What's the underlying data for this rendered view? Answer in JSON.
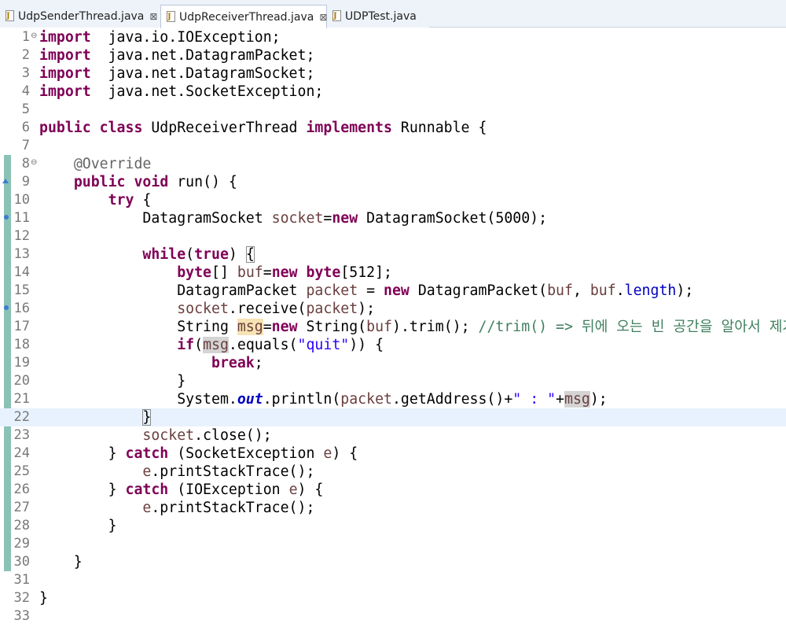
{
  "tabs": [
    {
      "label": "UdpSenderThread.java",
      "close": "⊠",
      "active": false
    },
    {
      "label": "UdpReceiverThread.java",
      "close": "⊠",
      "active": true
    },
    {
      "label": "UDPTest.java",
      "active": false
    }
  ],
  "editor": {
    "current_line": 22,
    "lines": [
      {
        "n": "1"
      },
      {
        "n": "2"
      },
      {
        "n": "3"
      },
      {
        "n": "4"
      },
      {
        "n": "5"
      },
      {
        "n": "6"
      },
      {
        "n": "7"
      },
      {
        "n": "8"
      },
      {
        "n": "9"
      },
      {
        "n": "10"
      },
      {
        "n": "11"
      },
      {
        "n": "12"
      },
      {
        "n": "13"
      },
      {
        "n": "14"
      },
      {
        "n": "15"
      },
      {
        "n": "16"
      },
      {
        "n": "17"
      },
      {
        "n": "18"
      },
      {
        "n": "19"
      },
      {
        "n": "20"
      },
      {
        "n": "21"
      },
      {
        "n": "22"
      },
      {
        "n": "23"
      },
      {
        "n": "24"
      },
      {
        "n": "25"
      },
      {
        "n": "26"
      },
      {
        "n": "27"
      },
      {
        "n": "28"
      },
      {
        "n": "29"
      },
      {
        "n": "30"
      },
      {
        "n": "31"
      },
      {
        "n": "32"
      },
      {
        "n": "33"
      }
    ]
  },
  "code": {
    "l1": [
      [
        "kw",
        "import"
      ],
      [
        "",
        "  java.io.IOException;"
      ]
    ],
    "l2": [
      [
        "kw",
        "import"
      ],
      [
        "",
        "  java.net.DatagramPacket;"
      ]
    ],
    "l3": [
      [
        "kw",
        "import"
      ],
      [
        "",
        "  java.net.DatagramSocket;"
      ]
    ],
    "l4": [
      [
        "kw",
        "import"
      ],
      [
        "",
        "  java.net.SocketException;"
      ]
    ],
    "l6": [
      [
        "kw",
        "public"
      ],
      [
        "",
        " "
      ],
      [
        "kw",
        "class"
      ],
      [
        "",
        " UdpReceiverThread "
      ],
      [
        "kw",
        "implements"
      ],
      [
        "",
        " Runnable {"
      ]
    ],
    "l8": [
      [
        "",
        "    "
      ],
      [
        "ann",
        "@Override"
      ]
    ],
    "l9": [
      [
        "",
        "    "
      ],
      [
        "kw",
        "public"
      ],
      [
        "",
        " "
      ],
      [
        "kw",
        "void"
      ],
      [
        "",
        " run() {"
      ]
    ],
    "l10": [
      [
        "",
        "        "
      ],
      [
        "kw",
        "try"
      ],
      [
        "",
        " {"
      ]
    ],
    "l11": [
      [
        "",
        "            DatagramSocket "
      ],
      [
        "var",
        "socket"
      ],
      [
        "",
        "="
      ],
      [
        "kw",
        "new"
      ],
      [
        "",
        " DatagramSocket(5000);"
      ]
    ],
    "l13": [
      [
        "",
        "            "
      ],
      [
        "kw",
        "while"
      ],
      [
        "",
        "("
      ],
      [
        "kw",
        "true"
      ],
      [
        "",
        ") "
      ],
      [
        "bracket",
        "{"
      ]
    ],
    "l14": [
      [
        "",
        "                "
      ],
      [
        "kw",
        "byte"
      ],
      [
        "",
        "[] "
      ],
      [
        "var",
        "buf"
      ],
      [
        "",
        "="
      ],
      [
        "kw",
        "new"
      ],
      [
        "",
        " "
      ],
      [
        "kw",
        "byte"
      ],
      [
        "",
        "[512];"
      ]
    ],
    "l15": [
      [
        "",
        "                DatagramPacket "
      ],
      [
        "var",
        "packet"
      ],
      [
        "",
        " = "
      ],
      [
        "kw",
        "new"
      ],
      [
        "",
        " DatagramPacket("
      ],
      [
        "var",
        "buf"
      ],
      [
        "",
        ", "
      ],
      [
        "var",
        "buf"
      ],
      [
        "",
        "."
      ],
      [
        "field",
        "length"
      ],
      [
        "",
        ");"
      ]
    ],
    "l16": [
      [
        "",
        "                "
      ],
      [
        "var",
        "socket"
      ],
      [
        "",
        ".receive("
      ],
      [
        "var",
        "packet"
      ],
      [
        "",
        ");"
      ]
    ],
    "l17": [
      [
        "",
        "                String "
      ],
      [
        "hlvar",
        "msg"
      ],
      [
        "",
        "="
      ],
      [
        "kw",
        "new"
      ],
      [
        "",
        " String("
      ],
      [
        "var",
        "buf"
      ],
      [
        "",
        ").trim(); "
      ],
      [
        "cm",
        "//trim() => 뒤에 오는 빈 공간을 알아서 제거"
      ]
    ],
    "l18": [
      [
        "",
        "                "
      ],
      [
        "kw",
        "if"
      ],
      [
        "",
        "("
      ],
      [
        "hl2var",
        "msg"
      ],
      [
        "",
        ".equals("
      ],
      [
        "str",
        "\"quit\""
      ],
      [
        "",
        ")) {"
      ]
    ],
    "l19": [
      [
        "",
        "                    "
      ],
      [
        "kw",
        "break"
      ],
      [
        "",
        ";"
      ]
    ],
    "l20": [
      [
        "",
        "                }"
      ]
    ],
    "l21": [
      [
        "",
        "                System."
      ],
      [
        "sfield",
        "out"
      ],
      [
        "",
        ".println("
      ],
      [
        "var",
        "packet"
      ],
      [
        "",
        ".getAddress()+"
      ],
      [
        "str",
        "\" : \""
      ],
      [
        "",
        "+"
      ],
      [
        "hl2var",
        "msg"
      ],
      [
        "",
        ");"
      ]
    ],
    "l22": [
      [
        "",
        "            "
      ],
      [
        "bracket",
        "}"
      ]
    ],
    "l23": [
      [
        "",
        "            "
      ],
      [
        "var",
        "socket"
      ],
      [
        "",
        ".close();"
      ]
    ],
    "l24": [
      [
        "",
        "        } "
      ],
      [
        "kw",
        "catch"
      ],
      [
        "",
        " (SocketException "
      ],
      [
        "var",
        "e"
      ],
      [
        "",
        ") {"
      ]
    ],
    "l25": [
      [
        "",
        "            "
      ],
      [
        "var",
        "e"
      ],
      [
        "",
        ".printStackTrace();"
      ]
    ],
    "l26": [
      [
        "",
        "        } "
      ],
      [
        "kw",
        "catch"
      ],
      [
        "",
        " (IOException "
      ],
      [
        "var",
        "e"
      ],
      [
        "",
        ") {"
      ]
    ],
    "l27": [
      [
        "",
        "            "
      ],
      [
        "var",
        "e"
      ],
      [
        "",
        ".printStackTrace();"
      ]
    ],
    "l28": [
      [
        "",
        "        }"
      ]
    ],
    "l30": [
      [
        "",
        "    }"
      ]
    ],
    "l32": [
      [
        "",
        "}"
      ]
    ]
  },
  "icons": {
    "file_tab": "java-file-icon",
    "fold": "fold-toggle-icon",
    "override": "override-marker-icon",
    "occurrence": "occurrence-marker-icon"
  }
}
